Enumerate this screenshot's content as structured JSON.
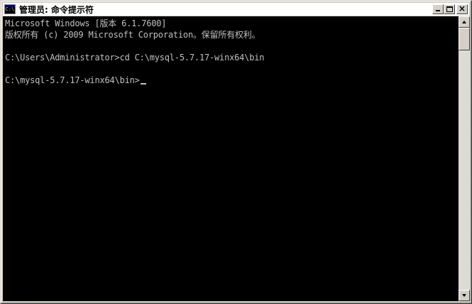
{
  "window": {
    "title": "管理员: 命令提示符",
    "icon_name": "cmd-icon",
    "icon_label": "C:\\"
  },
  "title_buttons": {
    "minimize_icon": "minimize-icon",
    "maximize_icon": "maximize-icon",
    "close_icon": "close-icon",
    "close_glyph": "×"
  },
  "console": {
    "background": "#000000",
    "foreground": "#c0c0c0",
    "lines": [
      "Microsoft Windows [版本 6.1.7600]",
      "版权所有 (c) 2009 Microsoft Corporation。保留所有权利。",
      "",
      "C:\\Users\\Administrator>cd C:\\mysql-5.7.17-winx64\\bin",
      "",
      "C:\\mysql-5.7.17-winx64\\bin>"
    ]
  },
  "scrollbar": {
    "up_icon": "scroll-up-arrow-icon",
    "down_icon": "scroll-down-arrow-icon"
  }
}
